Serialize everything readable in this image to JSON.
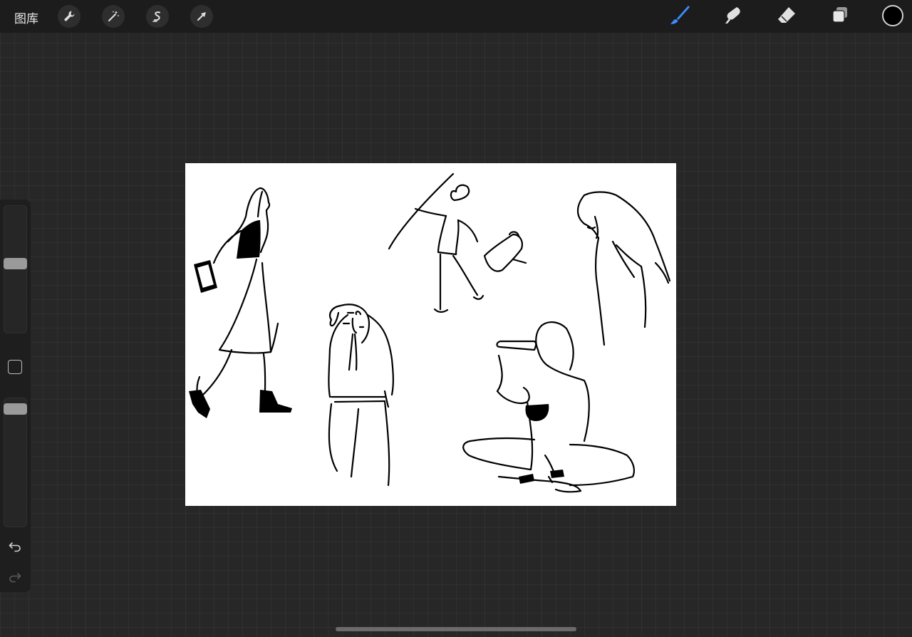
{
  "topbar": {
    "gallery_label": "图库"
  },
  "tools": {
    "left": [
      "wrench-icon",
      "magic-wand-icon",
      "selection-icon",
      "transform-arrow-icon"
    ],
    "right": [
      "brush-icon",
      "smudge-icon",
      "eraser-icon",
      "layers-icon"
    ],
    "active_tool": "brush-icon",
    "active_color": "#3d8bff",
    "current_color": "#000000"
  },
  "sidebar": {
    "brush_size_level": 0.55,
    "opacity_level": 0.05
  },
  "canvas": {
    "background": "#ffffff",
    "ink": "#000000"
  }
}
